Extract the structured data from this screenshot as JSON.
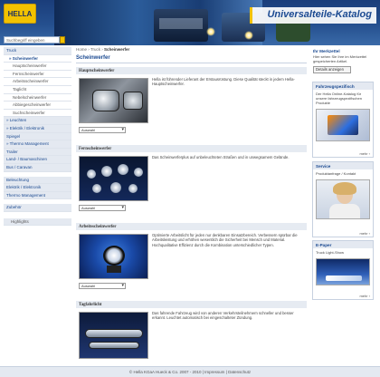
{
  "header": {
    "logo_text": "HELLA",
    "title": "Universalteile-Katalog",
    "search_placeholder": "Suchbegriff eingeben"
  },
  "leftnav": {
    "items": [
      {
        "label": "Truck",
        "type": "head"
      },
      {
        "label": "» Scheinwerfer",
        "type": "sel"
      },
      {
        "label": "Hauptscheinwerfer",
        "type": "sub"
      },
      {
        "label": "Fernscheinwerfer",
        "type": "sub"
      },
      {
        "label": "Arbeitsscheinwerfer",
        "type": "sub"
      },
      {
        "label": "Taglicht",
        "type": "sub"
      },
      {
        "label": "Nebelscheinwerfer",
        "type": "sub"
      },
      {
        "label": "Abbiegescheinwerfer",
        "type": "sub"
      },
      {
        "label": "Suchscheinwerfer",
        "type": "sub"
      },
      {
        "label": "» Leuchten",
        "type": "head"
      },
      {
        "label": "» Elektrik / Elektronik",
        "type": "head"
      },
      {
        "label": "Spiegel",
        "type": "head"
      },
      {
        "label": "» Thermo Management",
        "type": "head"
      },
      {
        "label": "Trailer",
        "type": "head"
      },
      {
        "label": "Land- / Baumaschinen",
        "type": "head"
      },
      {
        "label": "Bus / Caravan",
        "type": "head"
      },
      {
        "label": "Beleuchtung",
        "type": "head",
        "gap": true
      },
      {
        "label": "Elektrik / Elektronik",
        "type": "head"
      },
      {
        "label": "Thermo Management",
        "type": "head"
      },
      {
        "label": "Zubehör",
        "type": "head",
        "gap": true
      },
      {
        "label": "Highlights",
        "type": "highlight"
      }
    ]
  },
  "breadcrumb": {
    "home": "Home",
    "sep": " › ",
    "truck": "Truck",
    "current": "Scheinwerfer"
  },
  "page_title": "Scheinwerfer",
  "sections": [
    {
      "heading": "Hauptscheinwerfer",
      "text": "Hella ist führender Lieferant der Erstausrüstung. Diese Qualität steckt in jedem Hella-Hauptscheinwerfer.",
      "select": "Auswahl"
    },
    {
      "heading": "Fernscheinwerfer",
      "text": "Das Scheinwerferplus auf unbeleuchteten Straßen und in unwegsamem Gelände.",
      "select": "Auswahl"
    },
    {
      "heading": "Arbeitsscheinwerfer",
      "text": "Optimierte Arbeitslicht für jeden nur denkbaren Einsatzbereich. Verbessern spürbar die Arbeitsleistung und erhöhen wesentlich die Sicherheit bei Mensch und Material. Hochqualitative Effizienz durch die Kombination unterschiedlicher Typen.",
      "select": "Auswahl"
    },
    {
      "heading": "Tagfahrlicht",
      "text": "Das fahrende Fahrzeug wird von anderen Verkehrsteilnehmern schneller und besser erkannt. Leuchtet automatisch bei eingeschalteter Zündung.",
      "select": ""
    }
  ],
  "rightbar": {
    "merkzettel": {
      "heading": "Ihr Merkzettel",
      "text": "Hier sehen Sie Ihre im Merkzettel gespeicherten Artikel.",
      "button": "Details anzeigen"
    },
    "katalog": {
      "heading": "Fahrzeugspezifisch",
      "text": "Der Hella Online-Katalog für unsere fahrzeugspezifischen Produkte",
      "more": "mehr ›"
    },
    "service": {
      "heading": "Service",
      "text": "Produktanfrage / Kontakt",
      "more": "mehr ›"
    },
    "epaper": {
      "heading": "E-Paper",
      "text": "Truck Light-Show",
      "more": "mehr ›"
    }
  },
  "footer": {
    "text": "© Hella KGaA Hueck & Co. 2007 - 2010 | Impressum | Datenschutz"
  }
}
